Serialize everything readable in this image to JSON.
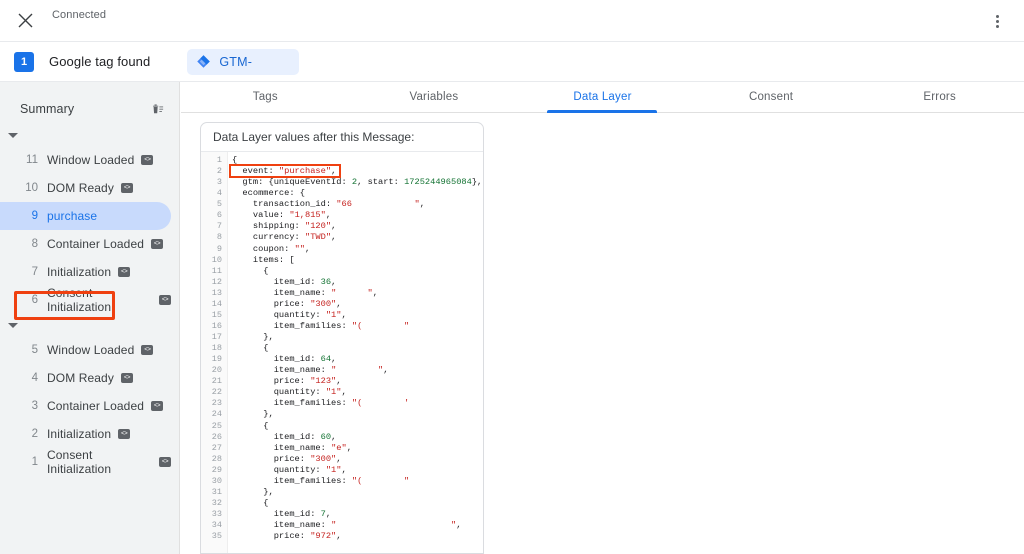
{
  "topbar": {
    "close_icon": "close-icon",
    "status": "Connected",
    "more_icon": "more-vert-icon"
  },
  "tagbar": {
    "count": "1",
    "label": "Google tag found",
    "chip_icon": "gtm-diamond-icon",
    "chip_label": "GTM-"
  },
  "sidebar": {
    "title": "Summary",
    "clear_icon": "delete-sweep-icon",
    "groups": [
      {
        "toggle_icon": "caret-down-icon",
        "events": [
          {
            "num": "11",
            "name": "Window Loaded",
            "badge": "code-badge-icon",
            "selected": false
          },
          {
            "num": "10",
            "name": "DOM Ready",
            "badge": "code-badge-icon",
            "selected": false
          },
          {
            "num": "9",
            "name": "purchase",
            "badge": "",
            "selected": true
          },
          {
            "num": "8",
            "name": "Container Loaded",
            "badge": "code-badge-icon",
            "selected": false
          },
          {
            "num": "7",
            "name": "Initialization",
            "badge": "code-badge-icon",
            "selected": false
          },
          {
            "num": "6",
            "name": "Consent Initialization",
            "badge": "code-badge-icon",
            "selected": false
          }
        ]
      },
      {
        "toggle_icon": "caret-down-icon",
        "events": [
          {
            "num": "5",
            "name": "Window Loaded",
            "badge": "code-badge-icon",
            "selected": false
          },
          {
            "num": "4",
            "name": "DOM Ready",
            "badge": "code-badge-icon",
            "selected": false
          },
          {
            "num": "3",
            "name": "Container Loaded",
            "badge": "code-badge-icon",
            "selected": false
          },
          {
            "num": "2",
            "name": "Initialization",
            "badge": "code-badge-icon",
            "selected": false
          },
          {
            "num": "1",
            "name": "Consent Initialization",
            "badge": "code-badge-icon",
            "selected": false
          }
        ]
      }
    ]
  },
  "tabs": [
    {
      "label": "Tags",
      "active": false
    },
    {
      "label": "Variables",
      "active": false
    },
    {
      "label": "Data Layer",
      "active": true
    },
    {
      "label": "Consent",
      "active": false
    },
    {
      "label": "Errors",
      "active": false
    }
  ],
  "code_panel": {
    "title": "Data Layer values after this Message:",
    "highlight_color": "#ef4010",
    "line_numbers": [
      "1",
      "2",
      "3",
      "4",
      "5",
      "6",
      "7",
      "8",
      "9",
      "10",
      "11",
      "12",
      "13",
      "14",
      "15",
      "16",
      "17",
      "18",
      "19",
      "20",
      "21",
      "22",
      "23",
      "24",
      "25",
      "26",
      "27",
      "28",
      "29",
      "30",
      "31",
      "32",
      "33",
      "34",
      "35"
    ],
    "lines": [
      "{",
      "  event: \"purchase\",",
      "  gtm: {uniqueEventId: 2, start: 1725244965084},",
      "  ecommerce: {",
      "    transaction_id: \"66            \",",
      "    value: \"1,815\",",
      "    shipping: \"120\",",
      "    currency: \"TWD\",",
      "    coupon: \"\",",
      "    items: [",
      "      {",
      "        item_id: 36,",
      "        item_name: \"      \",",
      "        price: \"300\",",
      "        quantity: \"1\",",
      "        item_families: \"(        \"",
      "      },",
      "      {",
      "        item_id: 64,",
      "        item_name: \"        \",",
      "        price: \"123\",",
      "        quantity: \"1\",",
      "        item_families: \"(        '",
      "      },",
      "      {",
      "        item_id: 60,",
      "        item_name: \"e\",",
      "        price: \"300\",",
      "        quantity: \"1\",",
      "        item_families: \"(        \"",
      "      },",
      "      {",
      "        item_id: 7,",
      "        item_name: \"                      \",",
      "        price: \"972\","
    ],
    "data_layer": {
      "event": "purchase",
      "gtm": {
        "uniqueEventId": 2,
        "start": 1725244965084
      },
      "ecommerce": {
        "transaction_id": "66",
        "value": "1,815",
        "shipping": "120",
        "currency": "TWD",
        "coupon": "",
        "items": [
          {
            "item_id": 36,
            "item_name": "",
            "price": "300",
            "quantity": "1",
            "item_families": ""
          },
          {
            "item_id": 64,
            "item_name": "",
            "price": "123",
            "quantity": "1",
            "item_families": ""
          },
          {
            "item_id": 60,
            "item_name": "e",
            "price": "300",
            "quantity": "1",
            "item_families": ""
          },
          {
            "item_id": 7,
            "item_name": "",
            "price": "972"
          }
        ]
      }
    }
  }
}
